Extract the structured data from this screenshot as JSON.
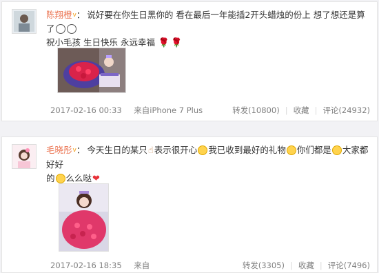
{
  "posts": [
    {
      "user": "陈翔橙",
      "text_segments": [
        "说好要在你生日黑你的 看在最后一年能插2开头蜡烛的份上 想了想还是算了",
        "祝小毛孩 生日快乐 永远幸福 "
      ],
      "time": "2017-02-16 00:33",
      "source_prefix": "来自",
      "source": "iPhone 7 Plus",
      "repost": "转发(10800)",
      "favorite": "收藏",
      "comment": "评论(24932)"
    },
    {
      "user": "毛晓彤",
      "text_segments": [
        "今天生日的某只",
        "表示很开心",
        "我已收到最好的礼物",
        "你们都是",
        "大家都好好",
        "的",
        "么么哒"
      ],
      "time": "2017-02-16 18:35",
      "source_prefix": "来自",
      "source": "",
      "repost": "转发(3305)",
      "favorite": "收藏",
      "comment": "评论(7496)"
    }
  ],
  "icons": {
    "vip": "vip-crown-icon",
    "emoji": [
      "clown-emoji-icon",
      "rose-emoji-icon",
      "smile-emoji-icon",
      "heart-emoji-icon",
      "hand-emoji-icon"
    ]
  },
  "colors": {
    "username": "#eb7350",
    "meta": "#808080"
  }
}
